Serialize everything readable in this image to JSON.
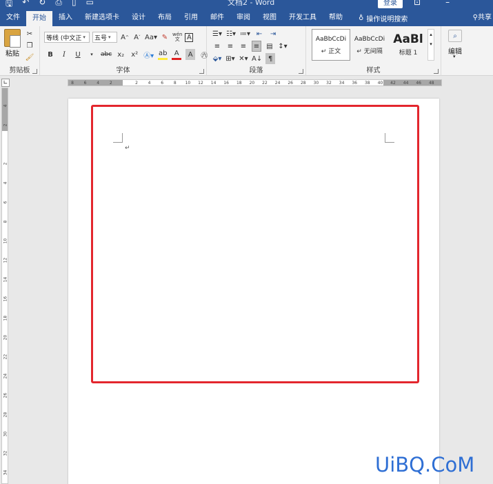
{
  "titlebar": {
    "doc_title": "文档2 - Word",
    "login": "登录"
  },
  "tabs": [
    {
      "label": "文件",
      "active": false
    },
    {
      "label": "开始",
      "active": true
    },
    {
      "label": "插入",
      "active": false
    },
    {
      "label": "新建选项卡",
      "active": false
    },
    {
      "label": "设计",
      "active": false
    },
    {
      "label": "布局",
      "active": false
    },
    {
      "label": "引用",
      "active": false
    },
    {
      "label": "邮件",
      "active": false
    },
    {
      "label": "审阅",
      "active": false
    },
    {
      "label": "视图",
      "active": false
    },
    {
      "label": "开发工具",
      "active": false
    },
    {
      "label": "帮助",
      "active": false
    }
  ],
  "tell_me": "操作说明搜索",
  "share": "共享",
  "ribbon": {
    "clipboard": {
      "paste": "粘贴",
      "label": "剪贴板"
    },
    "font": {
      "font_name": "等线 (中文正",
      "font_size": "五号",
      "change_case": "Aa",
      "phonetic": "wén",
      "char_border": "A",
      "bold": "B",
      "italic": "I",
      "underline": "U",
      "strike": "abc",
      "sub": "x₂",
      "sup": "x²",
      "label": "字体"
    },
    "paragraph": {
      "label": "段落"
    },
    "styles": {
      "items": [
        {
          "sample": "AaBbCcDi",
          "name": "↵ 正文"
        },
        {
          "sample": "AaBbCcDi",
          "name": "↵ 无间隔"
        },
        {
          "sample": "AaBl",
          "name": "标题 1"
        }
      ],
      "label": "样式"
    },
    "editing": {
      "label": "编辑"
    }
  },
  "ruler": {
    "h_ticks": [
      "8",
      "6",
      "4",
      "2",
      "",
      "2",
      "4",
      "6",
      "8",
      "10",
      "12",
      "14",
      "16",
      "18",
      "20",
      "22",
      "24",
      "26",
      "28",
      "30",
      "32",
      "34",
      "36",
      "38",
      "40",
      "42",
      "44",
      "46",
      "48"
    ],
    "v_ticks": [
      "4",
      "2",
      "",
      "2",
      "4",
      "6",
      "8",
      "10",
      "12",
      "14",
      "16",
      "18",
      "20",
      "22",
      "24",
      "26",
      "28",
      "30",
      "32",
      "34"
    ]
  },
  "watermark": "UiBQ.CoM",
  "colors": {
    "accent": "#2b579a",
    "highlight": "#e3262d",
    "watermark": "#2f6fd4"
  }
}
